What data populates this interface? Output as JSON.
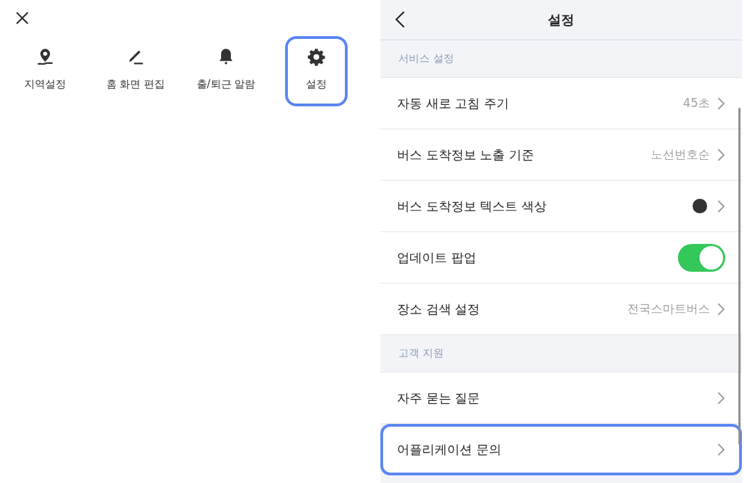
{
  "menu": {
    "items": [
      {
        "kind": "location",
        "label": "지역설정",
        "highlighted": false
      },
      {
        "kind": "edit",
        "label": "홈 화면 편집",
        "highlighted": false
      },
      {
        "kind": "bell",
        "label": "출/퇴근 알람",
        "highlighted": false
      },
      {
        "kind": "gear",
        "label": "설정",
        "highlighted": true
      }
    ]
  },
  "settings": {
    "title": "설정",
    "sections": [
      {
        "title": "서비스 설정",
        "rows": [
          {
            "kind": "value",
            "label": "자동 새로 고침 주기",
            "value": "45초",
            "highlighted": false
          },
          {
            "kind": "value",
            "label": "버스 도착정보 노출 기준",
            "value": "노선번호순",
            "highlighted": false
          },
          {
            "kind": "color",
            "label": "버스 도착정보 텍스트 색상",
            "color": "#333333",
            "highlighted": false
          },
          {
            "kind": "toggle",
            "label": "업데이트 팝업",
            "on": true,
            "highlighted": false
          },
          {
            "kind": "value",
            "label": "장소 검색 설정",
            "value": "전국스마트버스",
            "highlighted": false
          }
        ]
      },
      {
        "title": "고객 지원",
        "rows": [
          {
            "kind": "link",
            "label": "자주 묻는 질문",
            "highlighted": false
          },
          {
            "kind": "link",
            "label": "어플리케이션 문의",
            "highlighted": true
          }
        ]
      }
    ]
  }
}
